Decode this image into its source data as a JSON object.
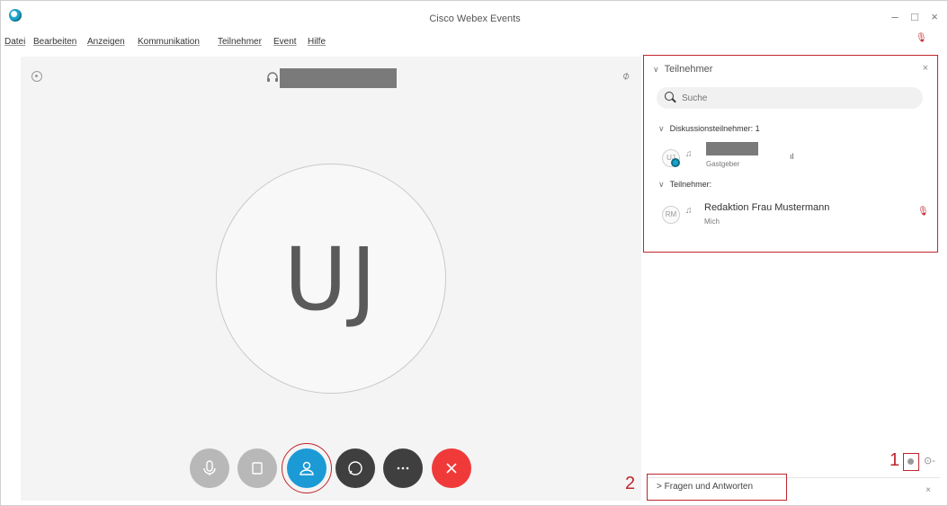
{
  "window": {
    "title": "Cisco Webex Events",
    "minimize": "–",
    "maximize": "□",
    "close": "×"
  },
  "menu": [
    "Datei",
    "Bearbeiten",
    "Anzeigen",
    "Kommunikation",
    "Teilnehmer",
    "Event",
    "Hilfe"
  ],
  "stage": {
    "avatar_initials": "UJ"
  },
  "controls": [
    "mute",
    "video",
    "participants",
    "chat",
    "more",
    "leave"
  ],
  "panel": {
    "title": "Teilnehmer",
    "search_placeholder": "Suche",
    "panelists_label": "Diskussionsteilnehmer: 1",
    "attendees_label": "Teilnehmer:",
    "panelist": {
      "initials": "UJ",
      "role": "Gastgeber"
    },
    "attendee": {
      "initials": "RM",
      "name": "Redaktion Frau Mustermann",
      "role": "Mich"
    }
  },
  "qa": {
    "label": "Fragen und Antworten"
  },
  "annotations": {
    "one": "1",
    "two": "2"
  },
  "colors": {
    "accent": "#1b9ad6",
    "highlight": "#c0262d",
    "leave": "#f03a3a"
  }
}
